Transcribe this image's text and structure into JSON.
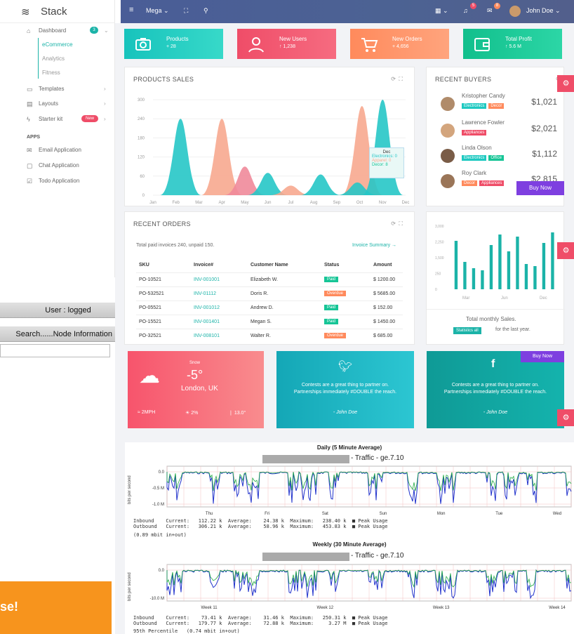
{
  "sidebar": {
    "brand": "Stack",
    "items": [
      {
        "label": "Dashboard",
        "badge": "3"
      },
      {
        "label": "eCommerce"
      },
      {
        "label": "Analytics"
      },
      {
        "label": "Fitness"
      },
      {
        "label": "Templates"
      },
      {
        "label": "Layouts"
      },
      {
        "label": "Starter kit",
        "badge": "New"
      }
    ],
    "apps_header": "APPS",
    "apps": [
      {
        "label": "Email Application"
      },
      {
        "label": "Chat Application"
      },
      {
        "label": "Todo Application"
      }
    ]
  },
  "topbar": {
    "menu": "Mega",
    "user": "John Doe",
    "notif1": "5",
    "notif2": "8"
  },
  "legacy": {
    "user_bar": "User : logged",
    "search_bar": "Search......Node Information"
  },
  "banner": {
    "text": "se!"
  },
  "stats": [
    {
      "title": "Products",
      "value": "+ 28",
      "color": "#1ec9c1"
    },
    {
      "title": "New Users",
      "value": "↑ 1,238",
      "color": "#ef4d68"
    },
    {
      "title": "New Orders",
      "value": "+ 4,656",
      "color": "#ff8a5c"
    },
    {
      "title": "Total Profit",
      "value": "↑ 5.6 M",
      "color": "#16c596"
    }
  ],
  "products_sales": {
    "title": "PRODUCTS SALES",
    "tooltip": {
      "month": "Dec",
      "l1": "Electronics: 0",
      "l2": "Apparel: 0",
      "l3": "Decor: 8"
    },
    "chart_data": {
      "type": "area",
      "x": [
        "Jan",
        "Feb",
        "Mar",
        "Apr",
        "May",
        "Jun",
        "Jul",
        "Aug",
        "Sep",
        "Oct",
        "Nov",
        "Dec"
      ],
      "yticks": [
        "0",
        "60",
        "120",
        "180",
        "240",
        "300"
      ],
      "ylim": [
        0,
        300
      ],
      "series": [
        {
          "name": "Electronics",
          "color": "#26c6c6",
          "values": [
            0,
            240,
            0,
            0,
            0,
            0,
            0,
            60,
            0,
            0,
            0,
            0
          ]
        },
        {
          "name": "Apparel",
          "color": "#f7a98f",
          "values": [
            0,
            0,
            0,
            240,
            0,
            0,
            0,
            0,
            0,
            280,
            0,
            0
          ]
        },
        {
          "name": "Decor",
          "color": "#ef8a9a",
          "values": [
            0,
            0,
            0,
            0,
            90,
            0,
            0,
            0,
            0,
            0,
            0,
            0
          ]
        }
      ],
      "peaks": [
        {
          "series": 0,
          "x": 1.2,
          "y": 240
        },
        {
          "series": 1,
          "x": 3.0,
          "y": 240
        },
        {
          "series": 2,
          "x": 4.0,
          "y": 90
        },
        {
          "series": 0,
          "x": 5.0,
          "y": 70
        },
        {
          "series": 1,
          "x": 6.0,
          "y": 30
        },
        {
          "series": 0,
          "x": 7.3,
          "y": 65
        },
        {
          "series": 1,
          "x": 9.1,
          "y": 280
        },
        {
          "series": 0,
          "x": 10.0,
          "y": 300
        },
        {
          "series": 0,
          "x": 8.9,
          "y": 40
        }
      ]
    }
  },
  "recent_buyers": {
    "title": "RECENT BUYERS",
    "buy_now": "Buy Now",
    "list": [
      {
        "name": "Kristopher Candy",
        "amount": "$1,021",
        "tags": [
          {
            "t": "Electronics",
            "c": "#1ec9c1"
          },
          {
            "t": "Decor",
            "c": "#ff8a5c"
          }
        ]
      },
      {
        "name": "Lawrence Fowler",
        "amount": "$2,021",
        "tags": [
          {
            "t": "Appliances",
            "c": "#ef4d68"
          }
        ]
      },
      {
        "name": "Linda Olson",
        "amount": "$1,112",
        "tags": [
          {
            "t": "Electronics",
            "c": "#1ec9c1"
          },
          {
            "t": "Office",
            "c": "#16c596"
          }
        ]
      },
      {
        "name": "Roy Clark",
        "amount": "$2,815",
        "tags": [
          {
            "t": "Decor",
            "c": "#ff8a5c"
          },
          {
            "t": "Appliances",
            "c": "#ef4d68"
          }
        ]
      }
    ]
  },
  "recent_orders": {
    "title": "RECENT ORDERS",
    "summary": "Total paid invoices 240, unpaid 150.",
    "link": "Invoice Summary →",
    "headers": [
      "SKU",
      "Invoice#",
      "Customer Name",
      "Status",
      "Amount"
    ],
    "rows": [
      [
        "PO-10521",
        "INV-001001",
        "Elizabeth W.",
        "Paid",
        "$ 1200.00"
      ],
      [
        "PO-532521",
        "INV-01112",
        "Doris R.",
        "Overdue",
        "$ 5685.00"
      ],
      [
        "PO-05521",
        "INV-001012",
        "Andrew D.",
        "Paid",
        "$ 152.00"
      ],
      [
        "PO-15521",
        "INV-001401",
        "Megan S.",
        "Paid",
        "$ 1450.00"
      ],
      [
        "PO-32521",
        "INV-008101",
        "Walter R.",
        "Overdue",
        "$ 685.00"
      ]
    ]
  },
  "monthly_sales": {
    "label": "Total monthly Sales.",
    "button": "Statistics all",
    "sub": "for the last year.",
    "chart_data": {
      "type": "bar",
      "yticks": [
        "0",
        "250",
        "1,500",
        "2,250",
        "3,000"
      ],
      "xticks": [
        "Mar",
        "Jun",
        "Dec"
      ],
      "values": [
        2300,
        1300,
        1000,
        900,
        2100,
        2600,
        1800,
        2500,
        1200,
        1100,
        2200,
        2700
      ],
      "ylim": [
        0,
        3000
      ]
    }
  },
  "weather": {
    "cond": "Snow",
    "temp": "-5°",
    "place": "London, UK",
    "wind": "2MPH",
    "rain": "2%",
    "temp2": "13.0°"
  },
  "twitter": {
    "text": "Contests are a great thing to partner on. Partnerships immediately #DOUBLE the reach.",
    "author": "- John Doe"
  },
  "facebook": {
    "text": "Contests are a great thing to partner on. Partnerships immediately #DOUBLE the reach.",
    "author": "- John Doe",
    "button": "Buy Now"
  },
  "mrtg": {
    "daily_title": "Daily (5 Minute Average)",
    "traffic_label": "- Traffic - ge.7.10",
    "y_label": "bits per second",
    "daily_yticks": [
      "0.0",
      "-0.5 M",
      "-1.0 M"
    ],
    "daily_xticks": [
      "Thu",
      "Fri",
      "Sat",
      "Sun",
      "Mon",
      "Tue",
      "Wed"
    ],
    "daily_stats": "Inbound    Current:   112.22 k  Average:    24.38 k  Maximum:   238.40 k  ■ Peak Usage\nOutbound   Current:   306.21 k  Average:    58.96 k  Maximum:   453.83 k  ■ Peak Usage",
    "daily_foot": "(0.89 mbit in+out)",
    "weekly_title": "Weekly (30 Minute Average)",
    "weekly_yticks": [
      "0.0",
      "-10.0 M"
    ],
    "weekly_xticks": [
      "Week 11",
      "Week 12",
      "Week 13",
      "Week 14"
    ],
    "weekly_stats": "Inbound    Current:    73.41 k  Average:    31.46 k  Maximum:   250.31 k  ■ Peak Usage\nOutbound   Current:   179.77 k  Average:    72.88 k  Maximum:     3.27 M  ■ Peak Usage",
    "weekly_foot": "95th Percentile   (0.74 mbit in+out)"
  }
}
